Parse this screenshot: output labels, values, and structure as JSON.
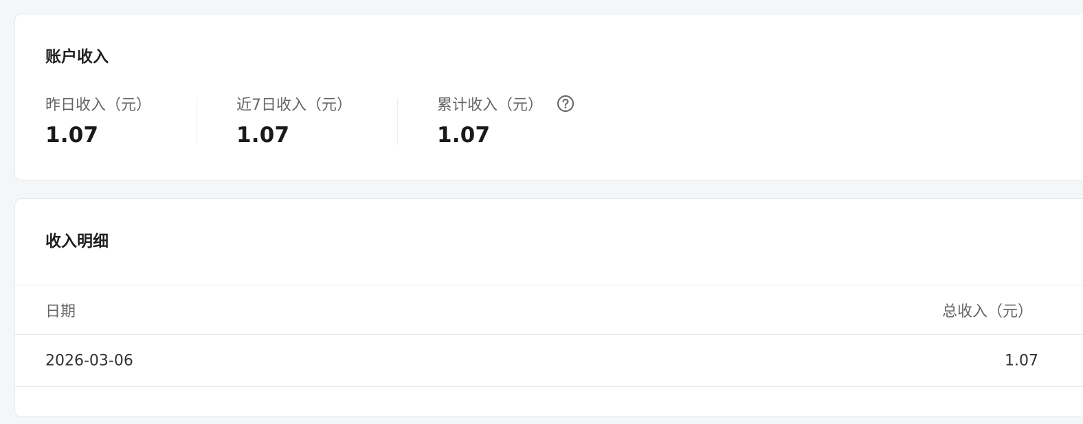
{
  "account": {
    "title": "账户收入",
    "stats": [
      {
        "label": "昨日收入（元）",
        "value": "1.07"
      },
      {
        "label": "近7日收入（元）",
        "value": "1.07"
      },
      {
        "label": "累计收入（元）",
        "value": "1.07",
        "icon": "help-circle-icon"
      }
    ]
  },
  "detail": {
    "title": "收入明细",
    "columns": [
      "日期",
      "总收入（元）"
    ],
    "rows": [
      {
        "date": "2026-03-06",
        "total": "1.07"
      }
    ]
  }
}
